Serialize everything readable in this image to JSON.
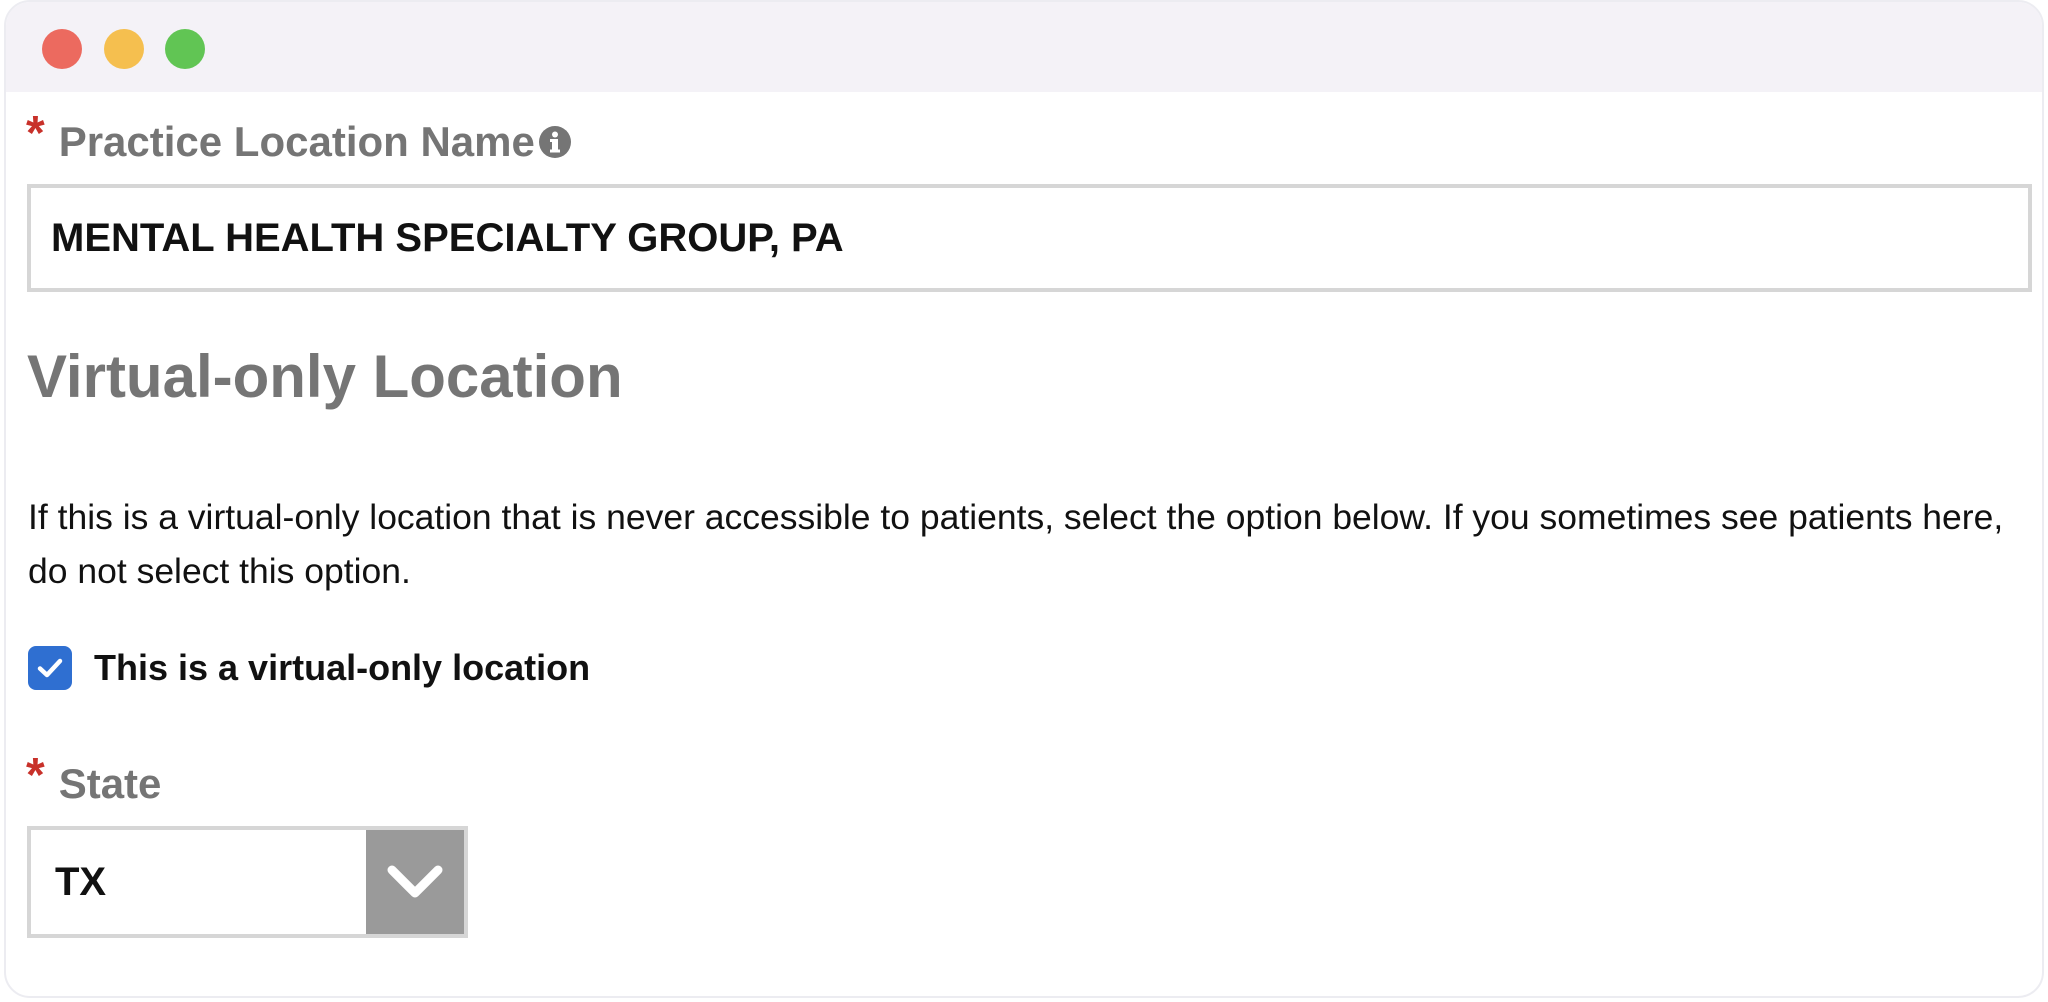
{
  "form": {
    "practice_location": {
      "required_marker": "*",
      "label": "Practice Location Name",
      "info_icon": "info-circle-icon",
      "value": "MENTAL HEALTH SPECIALTY GROUP, PA"
    },
    "virtual_section": {
      "heading": "Virtual-only Location",
      "description": "If this is a virtual-only location that is never accessible to patients, select the option below. If you sometimes see patients here, do not select this option.",
      "checkbox_label": "This is a virtual-only location",
      "checkbox_checked": true,
      "checkbox_icon": "checkmark-icon"
    },
    "state": {
      "required_marker": "*",
      "label": "State",
      "value": "TX",
      "dropdown_icon": "chevron-down-icon"
    }
  },
  "colors": {
    "required": "#c8312a",
    "label": "#757575",
    "checkbox": "#2f6fd1",
    "dropdown_button": "#9a9a9a",
    "titlebar": "#f4f2f7"
  }
}
